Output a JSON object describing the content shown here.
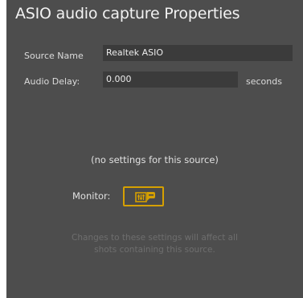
{
  "dialog": {
    "title": "ASIO audio capture Properties"
  },
  "form": {
    "source_name_label": "Source Name",
    "source_name_value": "Realtek ASIO",
    "audio_delay_label": "Audio Delay:",
    "audio_delay_value": "0.000",
    "audio_delay_unit": "seconds"
  },
  "body": {
    "no_settings_text": "(no settings for this source)",
    "monitor_label": "Monitor:",
    "monitor_icon": "monitor-audio-icon",
    "footer_line1": "Changes to these settings will affect all",
    "footer_line2": "shots containing this source."
  },
  "colors": {
    "panel_bg": "#4d4d4d",
    "field_bg": "#3b3b3b",
    "accent": "#d6a000",
    "muted_text": "#6e6e6e"
  }
}
